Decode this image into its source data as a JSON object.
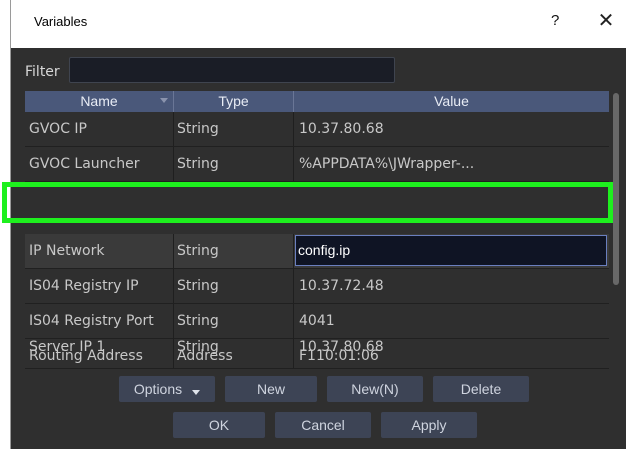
{
  "window": {
    "title": "Variables",
    "help_label": "?",
    "close_label": "✕"
  },
  "filter": {
    "label": "Filter",
    "value": ""
  },
  "table": {
    "columns": [
      "Name",
      "Type",
      "Value"
    ],
    "rows": [
      {
        "name": "GVOC IP",
        "type": "String",
        "value": "10.37.80.68"
      },
      {
        "name": "GVOC Launcher",
        "type": "String",
        "value": "%APPDATA%\\JWrapper-..."
      },
      {
        "name": "IP Network",
        "type": "String",
        "value": "config.ip"
      },
      {
        "name": "IS04 Registry IP",
        "type": "String",
        "value": "10.37.72.48"
      },
      {
        "name": "IS04 Registry Port",
        "type": "String",
        "value": "4041"
      },
      {
        "name": "Routing Address",
        "type": "Address",
        "value": "F110:01:06"
      },
      {
        "name": "Server IP 1",
        "type": "String",
        "value": "10.37.80.68"
      }
    ],
    "selected_row": 2
  },
  "buttons": {
    "options": "Options",
    "new": "New",
    "new_n": "New(N)",
    "delete": "Delete",
    "ok": "OK",
    "cancel": "Cancel",
    "apply": "Apply"
  },
  "colors": {
    "background": "#2f2f2f",
    "header": "#4a587a",
    "button": "#3d4455",
    "highlight": "#1ef01e"
  },
  "icons": {
    "sort": "sort-caret-icon",
    "dropdown": "chevron-down-icon"
  }
}
